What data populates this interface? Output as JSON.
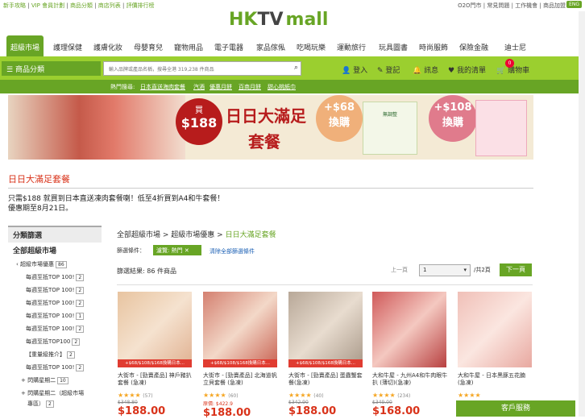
{
  "topbar": {
    "left": [
      "新手攻略",
      "VIP 會員計劃",
      "商品分類",
      "商店列表",
      "評價排行榜"
    ],
    "right": [
      "O2O門市",
      "常見問題",
      "工作機會",
      "商品加盟"
    ],
    "lang": "ENG"
  },
  "logo": {
    "h": "HK",
    "tv": "TV",
    "mall": "mall"
  },
  "nav": {
    "active": "超級市場",
    "items": [
      "護理保健",
      "護膚化妝",
      "母嬰育兒",
      "寵物用品",
      "電子電器",
      "家品傢俬",
      "吃喝玩樂",
      "運動旅行",
      "玩具圖書",
      "時尚服飾",
      "保險金融",
      "迪士尼"
    ]
  },
  "greenbar": {
    "category": "商品分類",
    "search_placeholder": "輸入品牌或產品名稱，搜尋全港 319,238 件商品",
    "login": "登入",
    "register": "登記",
    "messages": "訊息",
    "wishlist": "我的清單",
    "cart": "購物車",
    "cart_count": "0"
  },
  "hotbar": {
    "label": "熱門搜尋:",
    "tags": [
      "日本直送海肉套餐",
      "汽酒",
      "優惠月餅",
      "百商月餅",
      "甜心桃紙巾"
    ]
  },
  "banner": {
    "buy": "買",
    "buy_price": "$188",
    "title": "日日大滿足",
    "subtitle": "套餐",
    "offer1_price": "+$68",
    "offer1_text": "換購",
    "product1": "無調整",
    "offer2_price": "+$108",
    "offer2_text": "換購"
  },
  "page": {
    "title": "日日大滿足套餐",
    "desc1": "只需$188 就買到日本直送凍肉套餐喇！低至4折買到A4和牛套餐！",
    "desc2": "優惠期至8月21日。"
  },
  "sidebar": {
    "header": "分類篩選",
    "section": "全部超級市場",
    "parent": "超級市場優惠",
    "parent_count": "86",
    "rows": [
      {
        "label": "每週至抵TOP 100!",
        "count": "2"
      },
      {
        "label": "每週至抵TOP 100!",
        "count": "2"
      },
      {
        "label": "每週至抵TOP 100!",
        "count": "2"
      },
      {
        "label": "每週至抵TOP 100!",
        "count": "1"
      },
      {
        "label": "每週至抵TOP 100!",
        "count": "2"
      },
      {
        "label": "每週至抵TOP100",
        "count": "2"
      },
      {
        "label": "【重量級推介】",
        "count": "2"
      },
      {
        "label": "每週至抵TOP 100!",
        "count": "2"
      },
      {
        "label": "+ 閃購星期二",
        "count": "10"
      },
      {
        "label": "+ 閃購星期二（超級市場",
        "count": ""
      },
      {
        "label": "專區）",
        "count": "2"
      }
    ]
  },
  "breadcrumb": {
    "a": "全部超級市場",
    "b": "超級市場優惠",
    "c": "日日大滿足套餐"
  },
  "filter": {
    "label": "篩選條件：",
    "chip": "濾覽: 熱門",
    "clear": "清除全部篩選條件"
  },
  "results": {
    "text": "篩選結果: 86 件商品"
  },
  "pager": {
    "prev": "上一頁",
    "page": "1",
    "total": "/共2頁",
    "next": "下一頁"
  },
  "products": [
    {
      "promo": "+$68/$108/$168換購日本...",
      "name": "大街市 - [勁賣產品] 神戶豬扒套餐 (急凍)",
      "stars": "★★★★",
      "reviews": "(57)",
      "old": "$348.80",
      "price": "$188.00"
    },
    {
      "promo": "+$68/$108/$168換購日本...",
      "name": "大街市 - [勁賣產品] 北海道帆立貝套餐 (急凍)",
      "stars": "★★★★",
      "reviews": "(60)",
      "old": "原價: $422.9",
      "price": "$188.00"
    },
    {
      "promo": "+$68/$108/$168換購日本...",
      "name": "大街市 - [勁賣產品] 蛋蟲蟹套餐(急凍)",
      "stars": "★★★★",
      "reviews": "(40)",
      "old": "$342.90",
      "price": "$188.00"
    },
    {
      "promo": "",
      "name": "大和牛屋 - 九州A4和牛肉眼牛扒 (薄切)(急凍)",
      "stars": "★★★★",
      "reviews": "(234)",
      "old": "$349.00",
      "price": "$168.00"
    },
    {
      "promo": "",
      "name": "大和牛屋 - 日本黑豚五花腩 (急凍)",
      "stars": "★★★★",
      "reviews": "",
      "old": "",
      "price": ""
    }
  ],
  "service": "客戶服務"
}
